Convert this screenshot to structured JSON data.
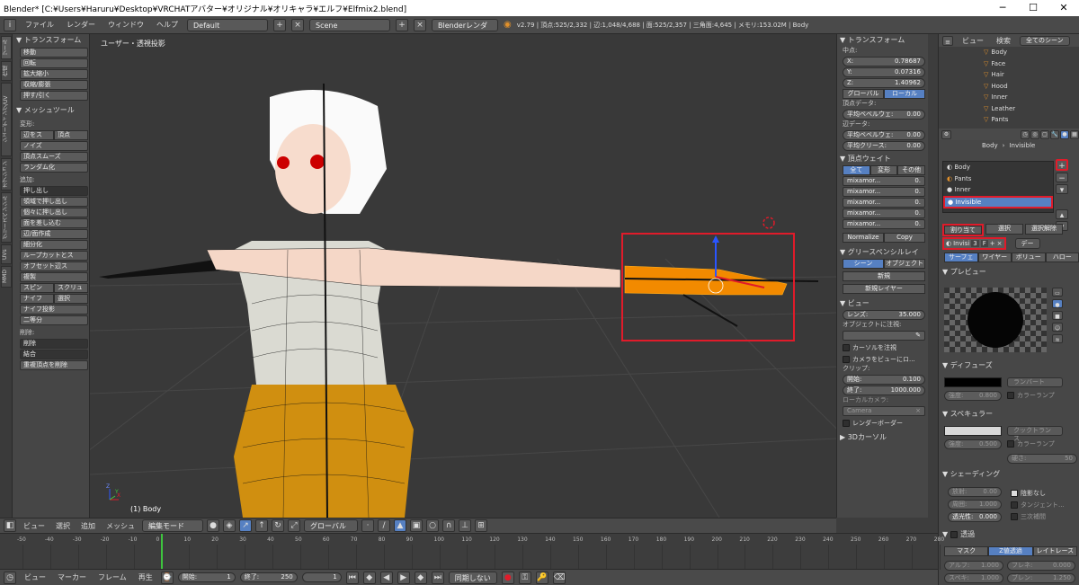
{
  "window": {
    "title": "Blender* [C:¥Users¥Haruru¥Desktop¥VRCHATアバター¥オリジナル¥オリキャラ¥エルフ¥Elfmix2.blend]",
    "min": "─",
    "max": "☐",
    "close": "✕"
  },
  "infobar": {
    "menus": [
      "ファイル",
      "レンダー",
      "ウィンドウ",
      "ヘルプ"
    ],
    "layout": "Default",
    "scene": "Scene",
    "engine": "Blenderレンダー",
    "stats": "v2.79 | 頂点:525/2,332 | 辺:1,048/4,688 | 面:525/2,357 | 三角面:4,645 | メモリ:153.02M | Body"
  },
  "lefttabs": [
    "ツール",
    "作成",
    "シェーディング/UV",
    "オプション",
    "グリースペンシル",
    "UVs",
    "MMD"
  ],
  "toolshelf": {
    "transform_header": "トランスフォーム",
    "transform": [
      "移動",
      "回転",
      "拡大縮小",
      "収縮/膨張",
      "押す/引く"
    ],
    "mesh_header": "メッシュツール",
    "deform_label": "変形:",
    "deform_row1": [
      "辺をス",
      "頂点"
    ],
    "deform": [
      "ノイズ",
      "頂点スムーズ",
      "ランダム化"
    ],
    "add_label": "追加:",
    "extrude": "押し出し",
    "add": [
      "領域で押し出し",
      "個々に押し出し",
      "面を差し込む",
      "辺/面作成",
      "細分化",
      "ループカットとス",
      "オフセット辺ス",
      "複製"
    ],
    "spin_row": [
      "スピン",
      "スクリュ"
    ],
    "knife_row": [
      "ナイフ",
      "選択"
    ],
    "add2": [
      "ナイフ投影",
      "二等分"
    ],
    "delete_label": "削除:",
    "delete": [
      "削除",
      "結合"
    ],
    "remove_doubles": "重複頂点を削除"
  },
  "viewport": {
    "label": "ユーザー・透視投影",
    "object": "(1) Body",
    "axes": {
      "x": "X",
      "y": "Y",
      "z": "Z"
    }
  },
  "vp_header": {
    "menus": [
      "ビュー",
      "選択",
      "追加",
      "メッシュ"
    ],
    "mode": "編集モード",
    "pivot": "グローバル"
  },
  "npanel": {
    "transform": {
      "header": "トランスフォーム",
      "median": "中点:",
      "x_label": "X:",
      "x": "0.78687",
      "y_label": "Y:",
      "y": "0.07316",
      "z_label": "Z:",
      "z": "1.40962",
      "global": "グローバル",
      "local": "ローカル"
    },
    "vertex_data": {
      "label": "頂点データ:",
      "bevel_label": "平均ベベルウェ:",
      "bevel": "0.00"
    },
    "edge_data": {
      "label": "辺データ:",
      "bevel_label": "平均ベベルウェ:",
      "bevel": "0.00",
      "crease_label": "平均クリース:",
      "crease": "0.00"
    },
    "weights": {
      "header": "頂点ウェイト",
      "tabs": [
        "全て",
        "変形",
        "その他"
      ],
      "rows": [
        {
          "name": "mixamor...",
          "val": "0."
        },
        {
          "name": "mixamor...",
          "val": "0."
        },
        {
          "name": "mixamor...",
          "val": "0."
        },
        {
          "name": "mixamor...",
          "val": "0."
        },
        {
          "name": "mixamor...",
          "val": "0."
        }
      ],
      "normalize": "Normalize",
      "copy": "Copy"
    },
    "grease": {
      "header": "グリースペンシルレイ",
      "scene": "シーン",
      "object": "オブジェクト",
      "new": "新規",
      "new_layer": "新規レイヤー"
    },
    "view": {
      "header": "ビュー",
      "lens_label": "レンズ:",
      "lens": "35.000",
      "lock_label": "オブジェクトに注視:",
      "cursor": "カーソルを注視",
      "cam": "カメラをビューにロ...",
      "clip": "クリップ:",
      "start_label": "開始:",
      "start": "0.100",
      "end_label": "終了:",
      "end": "1000.000",
      "localcam": "ローカルカメラ:",
      "camera": "Camera",
      "render_border": "レンダーボーダー"
    },
    "cursor3d": {
      "header": "3Dカーソル"
    }
  },
  "outliner": {
    "menus": [
      "ビュー",
      "検索"
    ],
    "scenes": "全てのシーン",
    "items": [
      "Body",
      "Face",
      "Hair",
      "Hood",
      "Inner",
      "Leather",
      "Pants"
    ]
  },
  "props": {
    "breadcrumb": [
      "Body",
      "Invisible"
    ],
    "slots": [
      "Body",
      "Pants",
      "Inner",
      "Invisible"
    ],
    "assign": "割り当て",
    "select": "選択",
    "deselect": "選択解除",
    "matname": "Invisi",
    "users": "3",
    "fake": "F",
    "data": "デー",
    "tabs": [
      "サーフェ",
      "ワイヤー",
      "ボリュー",
      "ハロー"
    ],
    "preview": "プレビュー",
    "diffuse": {
      "header": "ディフューズ",
      "shader": "ランバート",
      "intensity_label": "強度:",
      "intensity": "0.800",
      "ramp": "カラーランプ"
    },
    "specular": {
      "header": "スペキュラー",
      "shader": "クックトランス",
      "intensity_label": "強度:",
      "intensity": "0.500",
      "ramp": "カラーランプ",
      "hard_label": "硬さ:",
      "hard": "50"
    },
    "shading": {
      "header": "シェーディング",
      "emit_label": "放射:",
      "emit": "0.00",
      "ambient_label": "周囲:",
      "ambient": "1.000",
      "trans_label": "透光性:",
      "trans": "0.000",
      "shadeless": "陰影なし",
      "tangent": "タンジェント...",
      "cubic": "三次補間"
    },
    "transparency": {
      "header": "透過",
      "mask": "マスク",
      "zt": "Z値透過",
      "rt": "レイトレース",
      "alpha_label": "アルフ:",
      "alpha": "1.000",
      "fresnel_label": "フレネ:",
      "fresnel": "0.000",
      "spec_label": "スペキ:",
      "spec": "1.000",
      "blend_label": "ブレン:",
      "blend": "1.250"
    }
  },
  "timeline": {
    "ticks": [
      "-50",
      "-40",
      "-30",
      "-20",
      "-10",
      "0",
      "10",
      "20",
      "30",
      "40",
      "50",
      "60",
      "70",
      "80",
      "90",
      "100",
      "110",
      "120",
      "130",
      "140",
      "150",
      "160",
      "170",
      "180",
      "190",
      "200",
      "210",
      "220",
      "230",
      "240",
      "250",
      "260",
      "270",
      "280"
    ],
    "menus": [
      "ビュー",
      "マーカー",
      "フレーム",
      "再生"
    ],
    "start_label": "開始:",
    "start": "1",
    "end_label": "終了:",
    "end": "250",
    "current": "1",
    "sync": "同期しない"
  }
}
